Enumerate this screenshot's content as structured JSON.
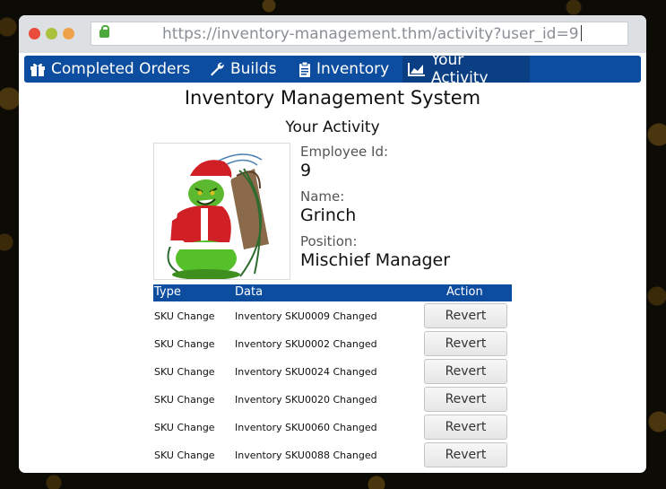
{
  "browser": {
    "url": "https://inventory-management.thm/activity?user_id=9"
  },
  "nav": {
    "items": [
      {
        "label": "Completed Orders",
        "icon": "gift-icon"
      },
      {
        "label": "Builds",
        "icon": "wrench-icon"
      },
      {
        "label": "Inventory",
        "icon": "clipboard-icon"
      },
      {
        "label": "Your Activity",
        "icon": "chart-icon",
        "active": true
      }
    ]
  },
  "page": {
    "title": "Inventory Management System",
    "subtitle": "Your Activity"
  },
  "profile": {
    "employee_id_label": "Employee Id:",
    "employee_id": "9",
    "name_label": "Name:",
    "name": "Grinch",
    "position_label": "Position:",
    "position": "Mischief Manager"
  },
  "table": {
    "headers": {
      "type": "Type",
      "data": "Data",
      "action": "Action"
    },
    "rows": [
      {
        "type": "SKU Change",
        "data": "Inventory SKU0009 Changed",
        "action": "Revert"
      },
      {
        "type": "SKU Change",
        "data": "Inventory SKU0002 Changed",
        "action": "Revert"
      },
      {
        "type": "SKU Change",
        "data": "Inventory SKU0024 Changed",
        "action": "Revert"
      },
      {
        "type": "SKU Change",
        "data": "Inventory SKU0020 Changed",
        "action": "Revert"
      },
      {
        "type": "SKU Change",
        "data": "Inventory SKU0060 Changed",
        "action": "Revert"
      },
      {
        "type": "SKU Change",
        "data": "Inventory SKU0088 Changed",
        "action": "Revert"
      }
    ]
  },
  "colors": {
    "nav_bg": "#0d4da0",
    "nav_active": "#0a3f84"
  }
}
